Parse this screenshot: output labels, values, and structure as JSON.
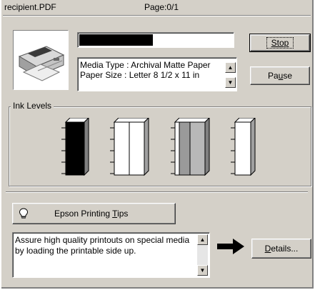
{
  "window": {
    "file_name": "recipient.PDF",
    "page_label": "Page:0/1"
  },
  "progress": {
    "fraction": 0.48,
    "color": "#000000"
  },
  "media_info": {
    "line1": "Media Type : Archival Matte Paper",
    "line2": "Paper Size : Letter 8 1/2 x 11 in"
  },
  "buttons": {
    "stop": "Stop",
    "pause_prefix": "Pa",
    "pause_mnemonic": "u",
    "pause_suffix": "se",
    "details_mnemonic": "D",
    "details_suffix": "etails..."
  },
  "ink_levels": {
    "label": "Ink Levels",
    "cartridges": [
      {
        "name": "black",
        "segments": [
          {
            "color": "#000000",
            "level": 1.0
          }
        ]
      },
      {
        "name": "color-1",
        "segments": [
          {
            "color": "#ffffff",
            "level": 1.0
          },
          {
            "color": "#ffffff",
            "level": 1.0
          }
        ]
      },
      {
        "name": "color-2",
        "segments": [
          {
            "color": "#9a9a9a",
            "level": 1.0
          },
          {
            "color": "#b8b8b8",
            "level": 1.0
          }
        ]
      },
      {
        "name": "color-3",
        "segments": [
          {
            "color": "#ffffff",
            "level": 1.0
          }
        ]
      }
    ]
  },
  "tips": {
    "button_prefix": "Epson Printing ",
    "button_mnemonic": "T",
    "button_suffix": "ips",
    "icon": "lightbulb-icon",
    "message": "Assure high quality printouts on special media by loading the printable side up."
  }
}
